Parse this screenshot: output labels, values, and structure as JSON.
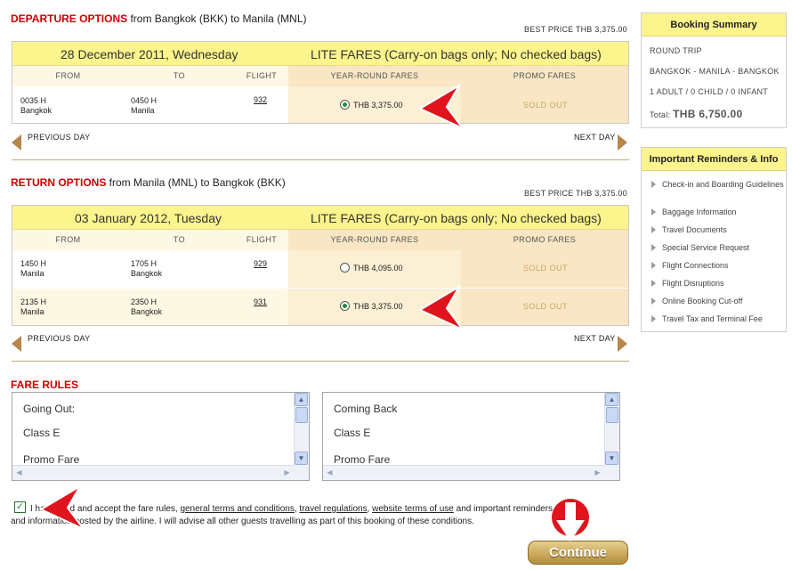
{
  "departure": {
    "title_red": "DEPARTURE OPTIONS",
    "title_rest": " from Bangkok (BKK) to Manila (MNL)",
    "best_price": "BEST PRICE THB  3,375.00",
    "date": "28 December 2011, Wednesday",
    "fare_type": "LITE FARES (Carry-on bags only; No checked bags)",
    "columns": [
      "FROM",
      "TO",
      "FLIGHT",
      "YEAR-ROUND FARES",
      "PROMO FARES"
    ],
    "flights": [
      {
        "dep_time": "0035 H",
        "dep_city": "Bangkok",
        "arr_time": "0450 H",
        "arr_city": "Manila",
        "flight": "932",
        "fare": "THB  3,375.00",
        "selected": true,
        "promo": "SOLD OUT"
      }
    ],
    "prev_day": "PREVIOUS DAY",
    "next_day": "NEXT DAY"
  },
  "return": {
    "title_red": "RETURN OPTIONS",
    "title_rest": " from Manila (MNL) to Bangkok (BKK)",
    "best_price": "BEST PRICE THB  3,375.00",
    "date": "03 January 2012, Tuesday",
    "fare_type": "LITE FARES (Carry-on bags only; No checked bags)",
    "columns": [
      "FROM",
      "TO",
      "FLIGHT",
      "YEAR-ROUND FARES",
      "PROMO FARES"
    ],
    "flights": [
      {
        "dep_time": "1450 H",
        "dep_city": "Manila",
        "arr_time": "1705 H",
        "arr_city": "Bangkok",
        "flight": "929",
        "fare": "THB  4,095.00",
        "selected": false,
        "promo": "SOLD OUT"
      },
      {
        "dep_time": "2135 H",
        "dep_city": "Manila",
        "arr_time": "2350 H",
        "arr_city": "Bangkok",
        "flight": "931",
        "fare": "THB  3,375.00",
        "selected": true,
        "promo": "SOLD OUT"
      }
    ],
    "prev_day": "PREVIOUS DAY",
    "next_day": "NEXT DAY"
  },
  "fare_rules": {
    "title": "FARE RULES",
    "going_out": [
      "Going Out:",
      "Class E",
      "Promo Fare"
    ],
    "coming_back": [
      "Coming Back",
      "Class E",
      "Promo Fare"
    ]
  },
  "agreement": {
    "part1": "I have read and accept the fare rules, ",
    "link_general": "general terms and conditions",
    "sep1": ", ",
    "link_travel": "travel regulations",
    "sep2": ", ",
    "link_website": "website terms of use",
    "part2": " and important reminders",
    "line2": "and information posted by the airline. I will advise all other guests travelling as part of this booking of these conditions.",
    "checked": true
  },
  "continue_label": "Continue",
  "booking_summary": {
    "title": "Booking Summary",
    "trip_type": "ROUND TRIP",
    "route": "BANGKOK - MANILA - BANGKOK",
    "pax": "1 ADULT / 0 CHILD / 0 INFANT",
    "total_label": "Total:",
    "total_value": "THB 6,750.00"
  },
  "reminders": {
    "title": "Important Reminders & Info",
    "items": [
      "Check-in and Boarding Guidelines",
      "Baggage Information",
      "Travel Documents",
      "Special Service Request",
      "Flight Connections",
      "Flight Disruptions",
      "Online Booking Cut-off",
      "Travel Tax and Terminal Fee"
    ]
  },
  "colors": {
    "accent_red": "#cc0000",
    "date_bar": "#fcf48c",
    "sold_out": "#c8a864",
    "button": "#b58c3a"
  }
}
